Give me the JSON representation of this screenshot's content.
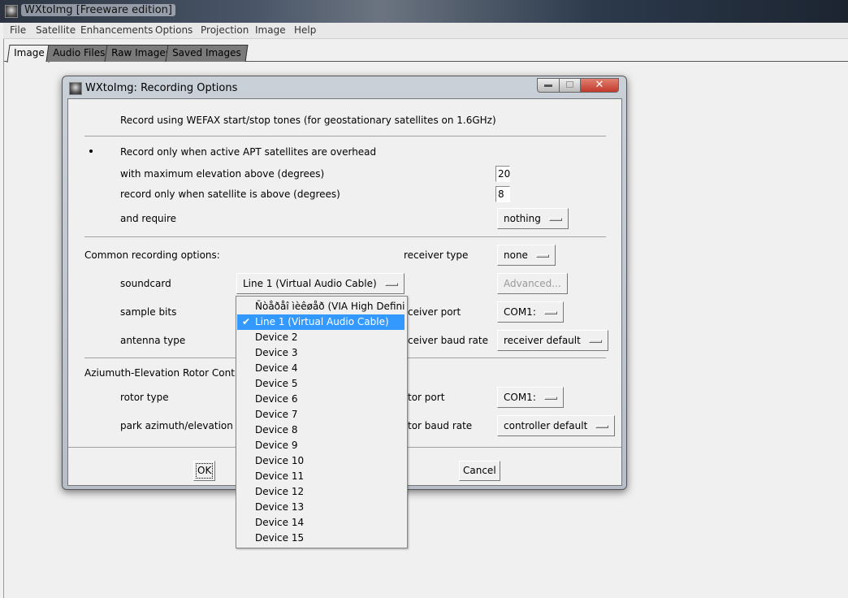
{
  "app": {
    "title": "WXtoImg [Freeware edition]"
  },
  "menu": [
    "File",
    "Satellite",
    "Enhancements",
    "Options",
    "Projection",
    "Image",
    "Help"
  ],
  "tabs": [
    {
      "label": "Image",
      "active": true
    },
    {
      "label": "Audio Files"
    },
    {
      "label": "Raw Images"
    },
    {
      "label": "Saved Images"
    }
  ],
  "dialog": {
    "title": "WXtoImg: Recording Options",
    "wefax_label": "Record using WEFAX start/stop tones (for geostationary satellites on 1.6GHz)",
    "apt_label": "Record only when active APT satellites are overhead",
    "max_elev_label": "with maximum elevation above (degrees)",
    "max_elev_value": "20",
    "min_elev_label": "record only when satellite is above (degrees)",
    "min_elev_value": "8",
    "require_label": "and require",
    "require_value": "nothing",
    "common_label": "Common recording options:",
    "receiver_type_label": "receiver type",
    "receiver_type_value": "none",
    "soundcard_label": "soundcard",
    "soundcard_value": "Line 1 (Virtual Audio Cable)",
    "advanced_label": "Advanced...",
    "sample_bits_label": "sample bits",
    "receiver_port_label": "receiver port",
    "receiver_port_value": "COM1:",
    "antenna_label": "antenna type",
    "receiver_baud_label": "receiver baud rate",
    "receiver_baud_value": "receiver default",
    "rotor_section_label": "Aziumuth-Elevation Rotor Control:",
    "rotor_type_label": "rotor type",
    "rotor_port_label": "rotor port",
    "rotor_port_value": "COM1:",
    "park_label": "park azimuth/elevation",
    "rotor_baud_label": "rotor baud rate",
    "rotor_baud_value": "controller default",
    "ok_label": "OK",
    "cancel_label": "Cancel"
  },
  "soundcard_options": [
    "Ñòåðåî ìèêøåð (VIA High Definit",
    "Line 1 (Virtual Audio Cable)",
    "Device 2",
    "Device 3",
    "Device 4",
    "Device 5",
    "Device 6",
    "Device 7",
    "Device 8",
    "Device 9",
    "Device 10",
    "Device 11",
    "Device 12",
    "Device 13",
    "Device 14",
    "Device 15"
  ],
  "soundcard_selected_index": 1,
  "colors": {
    "highlight": "#3399ff",
    "close_button": "#c9463d"
  }
}
